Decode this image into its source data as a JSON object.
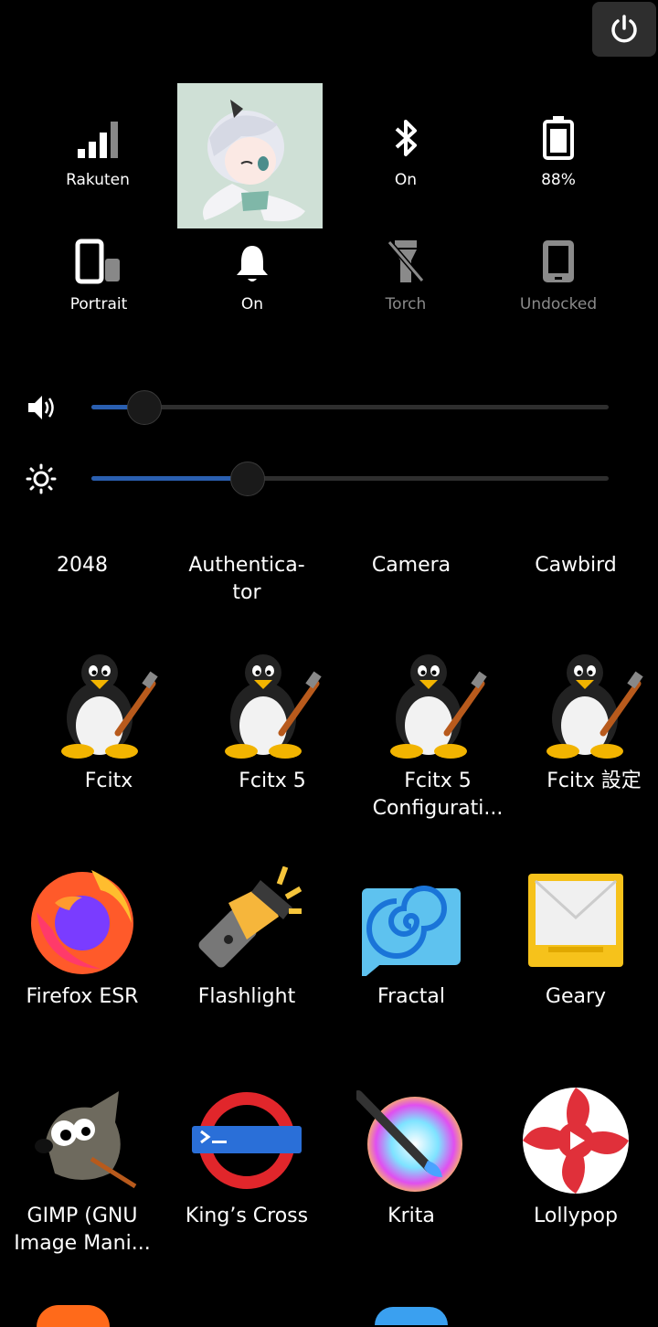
{
  "quick_settings": {
    "row1": [
      {
        "label": "Rakuten",
        "icon": "signal-icon"
      },
      {
        "label": "On",
        "icon": "bluetooth-icon"
      },
      {
        "label": "88%",
        "icon": "battery-icon"
      }
    ],
    "row2": [
      {
        "label": "Portrait",
        "icon": "rotation-icon"
      },
      {
        "label": "On",
        "icon": "bell-icon"
      },
      {
        "label": "Torch",
        "icon": "torch-off-icon"
      },
      {
        "label": "Undocked",
        "icon": "phone-icon"
      }
    ]
  },
  "sliders": {
    "volume": {
      "icon": "volume-icon",
      "level": 0.1
    },
    "brightness": {
      "icon": "brightness-icon",
      "level": 0.3
    }
  },
  "apps": {
    "row0": [
      "2048",
      "Authentica-\ntor",
      "Camera",
      "Cawbird"
    ],
    "row1": [
      "Fcitx",
      "Fcitx 5",
      "Fcitx 5\nConfigurati...",
      "Fcitx 設定"
    ],
    "row2": [
      "Firefox ESR",
      "Flashlight",
      "Fractal",
      "Geary"
    ],
    "row3": [
      "GIMP (GNU\nImage Mani...",
      "King’s Cross",
      "Krita",
      "Lollypop"
    ]
  },
  "colors": {
    "accent": "#2a5fb0",
    "background": "#000000",
    "dim_text": "#8a8a8a"
  }
}
